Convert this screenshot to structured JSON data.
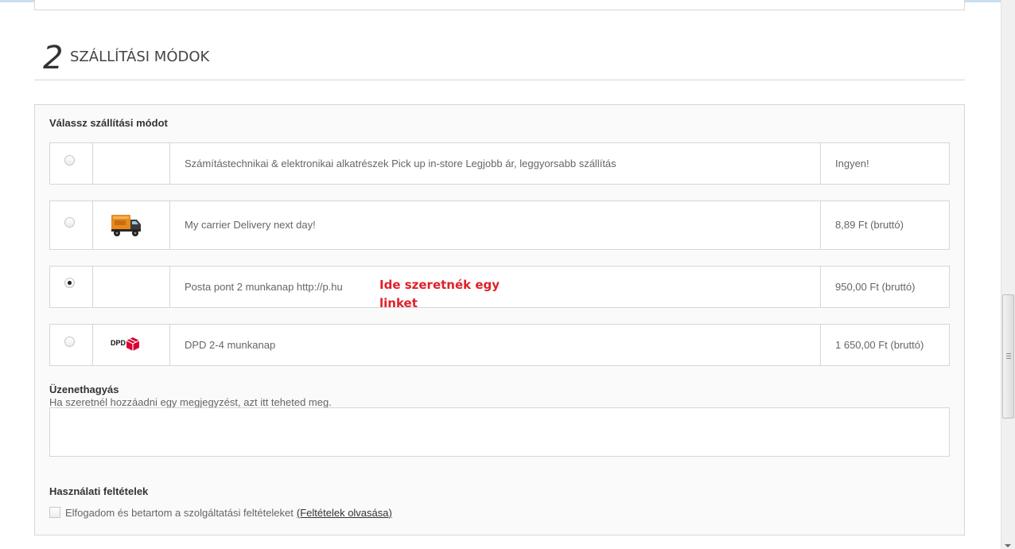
{
  "step": {
    "number": "2",
    "title": "SZÁLLÍTÁSI MÓDOK"
  },
  "shipping": {
    "choose_label": "Válassz szállítási módot",
    "carriers": [
      {
        "description": "Számítástechnikai & elektronikai alkatrészek Pick up in-store Legjobb ár, leggyorsabb szállítás",
        "price": "Ingyen!",
        "selected": false,
        "logo": ""
      },
      {
        "description": "My carrier Delivery next day!",
        "price": "8,89 Ft (bruttó)",
        "selected": false,
        "logo": "truck-icon"
      },
      {
        "description": "Posta pont 2 munkanap http://p.hu",
        "price": "950,00 Ft (bruttó)",
        "selected": true,
        "logo": ""
      },
      {
        "description": "DPD 2-4 munkanap",
        "price": "1 650,00 Ft (bruttó)",
        "selected": false,
        "logo": "dpd-logo-icon",
        "logo_text": "DPD"
      }
    ],
    "annotation": "Ide szeretnék egy linket",
    "annotation_color": "#e0202a"
  },
  "message": {
    "title": "Üzenethagyás",
    "hint": "Ha szeretnél hozzáadni egy megjegyzést, azt itt teheted meg.",
    "value": ""
  },
  "terms": {
    "title": "Használati feltételek",
    "checkbox_label": "Elfogadom és betartom a szolgáltatási feltételeket",
    "link_label": "(Feltételek olvasása)",
    "checked": false
  }
}
